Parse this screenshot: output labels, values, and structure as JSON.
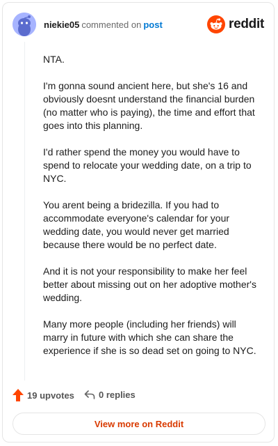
{
  "header": {
    "username": "niekie05",
    "action_text": "commented on",
    "link_text": "post",
    "logo_text": "reddit",
    "brand_color": "#ff4500",
    "avatar_icon": "snoo-avatar-icon"
  },
  "comment": {
    "paragraphs": [
      "NTA.",
      "I'm gonna sound ancient here, but she's 16 and obviously doesnt understand the financial burden (no matter who is paying), the time and effort that goes into this planning.",
      "I'd rather spend the money you would have to spend to relocate your wedding date, on a trip to NYC.",
      "You arent being a bridezilla. If you had to accommodate everyone's calendar for your wedding date, you would never get married because there would be no perfect date.",
      "And it is not your responsibility to make her feel better about missing out on her adoptive mother's wedding.",
      "Many more people (including her friends) will marry in future with which she can share the experience if she is so dead set on going to NYC."
    ]
  },
  "footer": {
    "upvotes_label": "19 upvotes",
    "replies_label": "0 replies",
    "upvote_color": "#ff4500"
  },
  "view_more": {
    "label": "View more on Reddit"
  }
}
